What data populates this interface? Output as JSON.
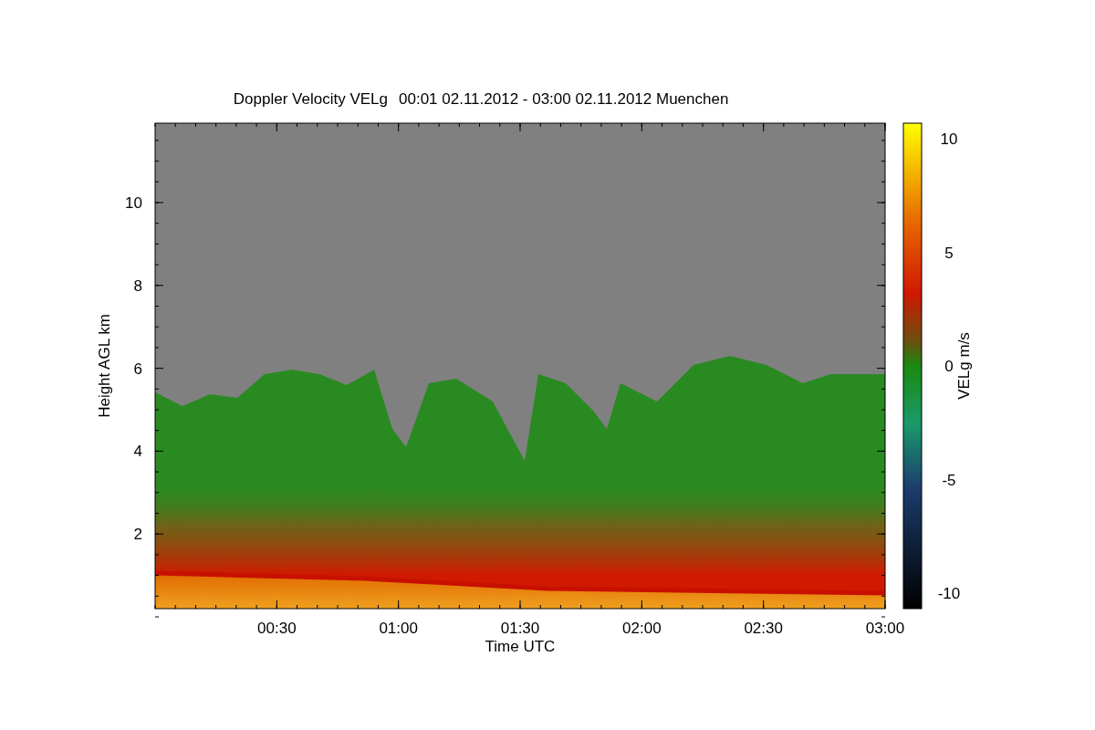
{
  "title": {
    "quantity": "Doppler Velocity VELg",
    "period": "00:01 02.11.2012 - 03:00 02.11.2012 Muenchen"
  },
  "plot": {
    "xlabel": "Time UTC",
    "ylabel": "Height AGL km",
    "xticks": [
      "00:30",
      "01:00",
      "01:30",
      "02:00",
      "02:30",
      "03:00"
    ],
    "yticks": [
      "10",
      "8",
      "6",
      "4",
      "2"
    ]
  },
  "colorbar": {
    "label": "VELg m/s",
    "ticks": [
      "10",
      "5",
      "0",
      "-5",
      "-10"
    ]
  }
}
